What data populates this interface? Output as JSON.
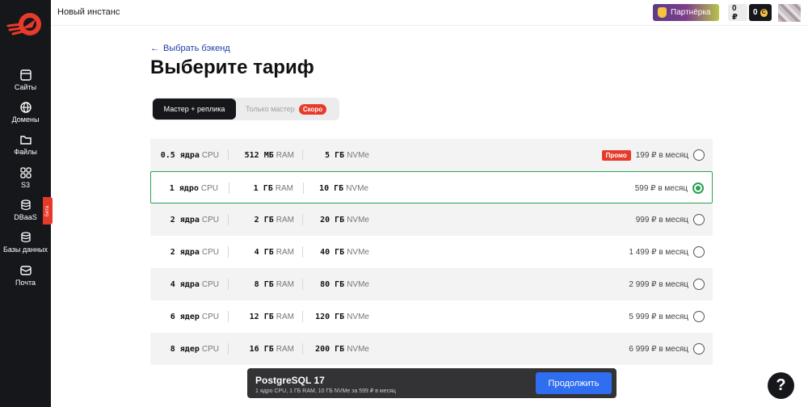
{
  "header": {
    "title": "Новый инстанс",
    "partner_label": "Партнёрка",
    "balance_rub": "0 ₽",
    "balance_coins": "0",
    "coin_symbol": "C"
  },
  "sidebar": {
    "items": [
      {
        "label": "Сайты",
        "icon": "window-icon"
      },
      {
        "label": "Домены",
        "icon": "globe-icon"
      },
      {
        "label": "Файлы",
        "icon": "folder-icon"
      },
      {
        "label": "S3",
        "icon": "grid-icon"
      },
      {
        "label": "DBaaS",
        "icon": "database-icon"
      },
      {
        "label": "Базы данных",
        "icon": "database-icon"
      },
      {
        "label": "Почта",
        "icon": "mail-icon"
      }
    ],
    "beta_label": "Бета"
  },
  "main": {
    "back_label": "Выбрать бэкенд",
    "title": "Выберите тариф",
    "toggle": {
      "option_a": "Мастер + реплика",
      "option_b": "Только мастер",
      "soon_badge": "Скоро"
    },
    "plans": [
      {
        "cpu": "0.5 ядра",
        "cpu_unit": "CPU",
        "ram": "512 МБ",
        "ram_unit": "RAM",
        "disk": "5 ГБ",
        "disk_unit": "NVMe",
        "price": "199 ₽ в месяц",
        "promo": "Промо",
        "selected": false
      },
      {
        "cpu": "1 ядро",
        "cpu_unit": "CPU",
        "ram": "1 ГБ",
        "ram_unit": "RAM",
        "disk": "10 ГБ",
        "disk_unit": "NVMe",
        "price": "599 ₽ в месяц",
        "promo": "",
        "selected": true
      },
      {
        "cpu": "2 ядра",
        "cpu_unit": "CPU",
        "ram": "2 ГБ",
        "ram_unit": "RAM",
        "disk": "20 ГБ",
        "disk_unit": "NVMe",
        "price": "999 ₽ в месяц",
        "promo": "",
        "selected": false
      },
      {
        "cpu": "2 ядра",
        "cpu_unit": "CPU",
        "ram": "4 ГБ",
        "ram_unit": "RAM",
        "disk": "40 ГБ",
        "disk_unit": "NVMe",
        "price": "1 499 ₽ в месяц",
        "promo": "",
        "selected": false
      },
      {
        "cpu": "4 ядра",
        "cpu_unit": "CPU",
        "ram": "8 ГБ",
        "ram_unit": "RAM",
        "disk": "80 ГБ",
        "disk_unit": "NVMe",
        "price": "2 999 ₽ в месяц",
        "promo": "",
        "selected": false
      },
      {
        "cpu": "6 ядер",
        "cpu_unit": "CPU",
        "ram": "12 ГБ",
        "ram_unit": "RAM",
        "disk": "120 ГБ",
        "disk_unit": "NVMe",
        "price": "5 999 ₽ в месяц",
        "promo": "",
        "selected": false
      },
      {
        "cpu": "8 ядер",
        "cpu_unit": "CPU",
        "ram": "16 ГБ",
        "ram_unit": "RAM",
        "disk": "200 ГБ",
        "disk_unit": "NVMe",
        "price": "6 999 ₽ в месяц",
        "promo": "",
        "selected": false
      }
    ]
  },
  "footer": {
    "title": "PostgreSQL 17",
    "summary": "1 ядро CPU, 1 ГБ RAM, 10 ГБ NVMe за 599 ₽ в месяц",
    "continue_label": "Продолжить"
  },
  "help_label": "?",
  "colors": {
    "accent": "#29a052",
    "primary_button": "#2f6ef0",
    "promo": "#e83a2a",
    "sidebar": "#16171b"
  }
}
